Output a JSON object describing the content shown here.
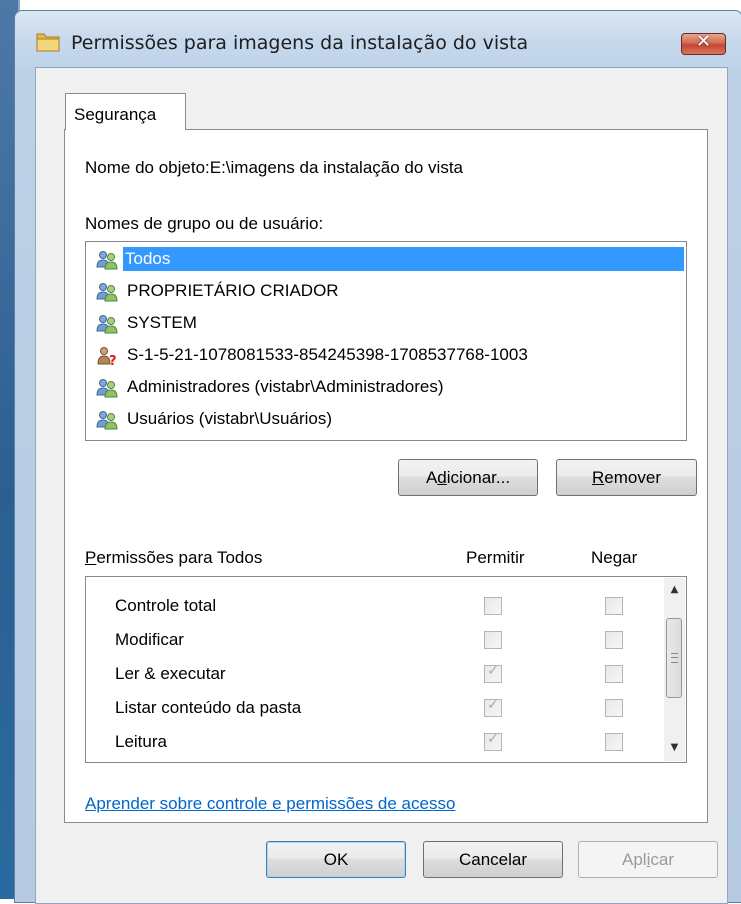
{
  "window": {
    "title": "Permissões para imagens da instalação do vista",
    "close_label": "✕"
  },
  "tabs": [
    {
      "label": "Segurança",
      "selected": true
    }
  ],
  "object": {
    "label": "Nome do objeto:",
    "value": "E:\\imagens da instalação do vista"
  },
  "groups": {
    "label_before": "Nomes de ",
    "label_mnemonic": "g",
    "label_after": "rupo ou de usuário:",
    "items": [
      {
        "name": "Todos",
        "icon": "users-group-icon",
        "selected": true
      },
      {
        "name": "PROPRIETÁRIO CRIADOR",
        "icon": "users-group-icon",
        "selected": false
      },
      {
        "name": "SYSTEM",
        "icon": "users-group-icon",
        "selected": false
      },
      {
        "name": "S-1-5-21-1078081533-854245398-1708537768-1003",
        "icon": "unknown-user-icon",
        "selected": false
      },
      {
        "name": "Administradores (vistabr\\Administradores)",
        "icon": "users-group-icon",
        "selected": false
      },
      {
        "name": "Usuários (vistabr\\Usuários)",
        "icon": "users-group-icon",
        "selected": false
      }
    ]
  },
  "buttons": {
    "add_before": "A",
    "add_mnemonic": "d",
    "add_after": "icionar...",
    "remove_mnemonic": "R",
    "remove_after": "emover",
    "ok": "OK",
    "cancel": "Cancelar",
    "apply_before": "Apl",
    "apply_mnemonic": "i",
    "apply_after": "car"
  },
  "permissions": {
    "label_mnemonic": "P",
    "label_after": "ermissões para Todos",
    "col_allow": "Permitir",
    "col_deny": "Negar",
    "rows": [
      {
        "name": "Controle total",
        "allow": false,
        "deny": false
      },
      {
        "name": "Modificar",
        "allow": false,
        "deny": false
      },
      {
        "name": "Ler & executar",
        "allow": true,
        "deny": false
      },
      {
        "name": "Listar conteúdo da pasta",
        "allow": true,
        "deny": false
      },
      {
        "name": "Leitura",
        "allow": true,
        "deny": false
      }
    ]
  },
  "help_link": "Aprender sobre controle e permissões de acesso",
  "colors": {
    "selection": "#3399ff",
    "link": "#0066cc",
    "close_button": "#c14733"
  }
}
